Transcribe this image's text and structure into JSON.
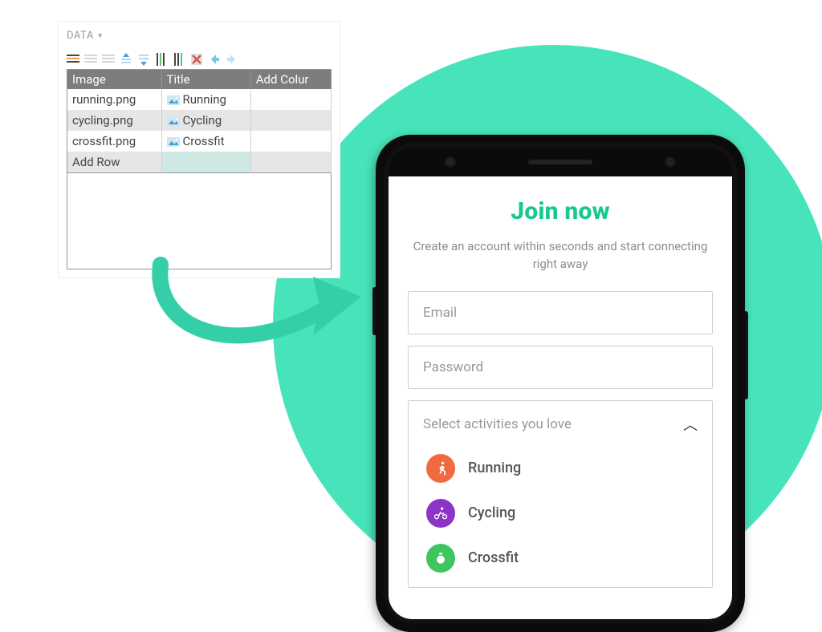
{
  "editor": {
    "panel_label": "DATA",
    "columns": [
      "Image",
      "Title",
      "Add Colur"
    ],
    "rows": [
      {
        "image": "running.png",
        "title": "Running"
      },
      {
        "image": "cycling.png",
        "title": "Cycling"
      },
      {
        "image": "crossfit.png",
        "title": "Crossfit"
      }
    ],
    "add_row_label": "Add Row"
  },
  "phone": {
    "title": "Join now",
    "subtitle": "Create an account within seconds and start connecting right away",
    "email_placeholder": "Email",
    "password_placeholder": "Password",
    "dropdown_label": "Select activities you love",
    "activities": [
      {
        "name": "Running",
        "icon": "runner-icon",
        "color": "ico-run"
      },
      {
        "name": "Cycling",
        "icon": "cyclist-icon",
        "color": "ico-cyc"
      },
      {
        "name": "Crossfit",
        "icon": "kettlebell-icon",
        "color": "ico-cross"
      }
    ]
  }
}
